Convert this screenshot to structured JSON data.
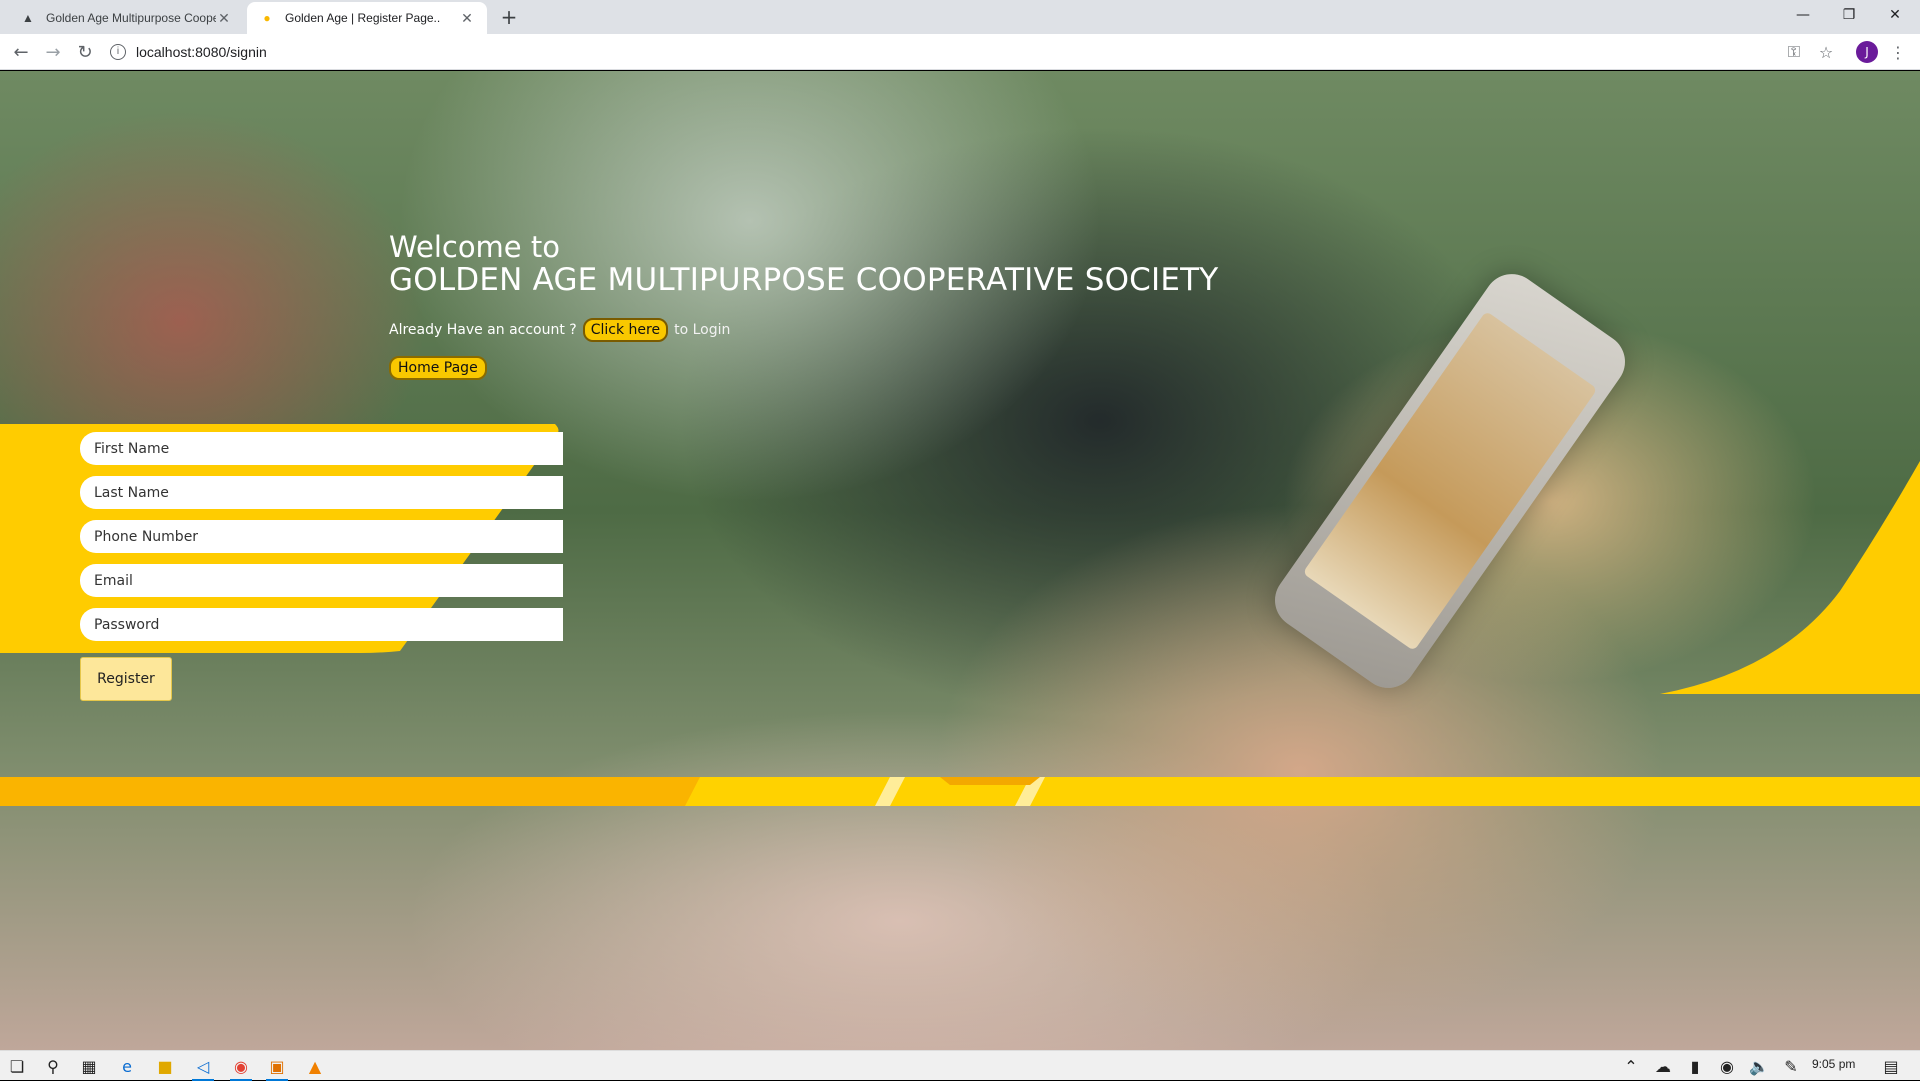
{
  "browser": {
    "tabs": [
      {
        "title": "Golden Age Multipurpose Coope",
        "favicon": "golden-age-icon",
        "active": false
      },
      {
        "title": "Golden Age | Register Page..",
        "favicon": "golden-age-icon",
        "active": true
      }
    ],
    "new_tab_symbol": "+",
    "url": "localhost:8080/signin",
    "profile_initial": "J"
  },
  "hero": {
    "welcome_line1": "Welcome to",
    "welcome_line2": "GOLDEN AGE MULTIPURPOSE COOPERATIVE SOCIETY",
    "already_text": "Already Have an account ?",
    "click_here_label": "Click here",
    "to_login_text": "to Login",
    "home_page_label": "Home Page"
  },
  "form": {
    "first_name_placeholder": "First Name",
    "last_name_placeholder": "Last Name",
    "phone_placeholder": "Phone Number",
    "email_placeholder": "Email",
    "password_placeholder": "Password",
    "register_label": "Register"
  },
  "taskbar": {
    "time": "9:05 pm"
  },
  "colors": {
    "accent": "#ffcc00",
    "accent_dark": "#f9a800"
  }
}
